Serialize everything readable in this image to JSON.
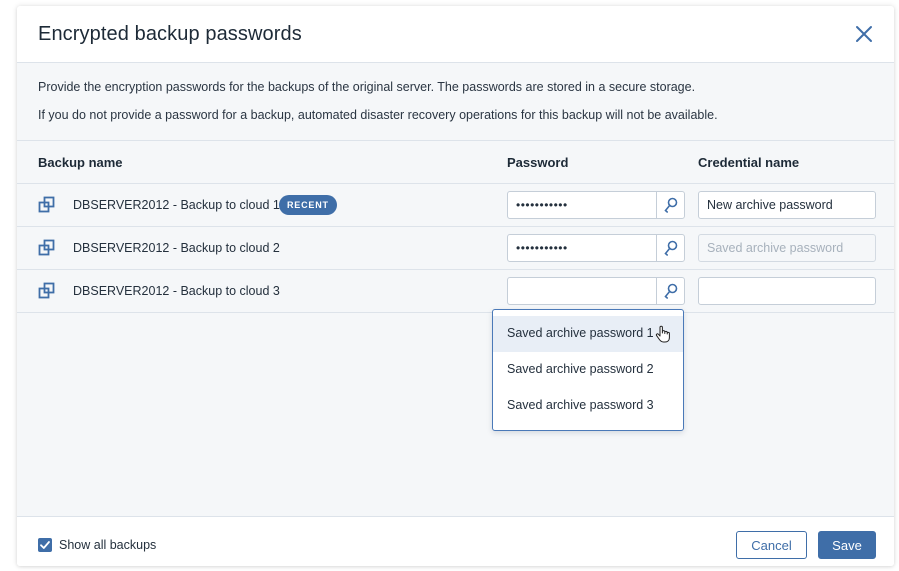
{
  "dialog": {
    "title": "Encrypted backup passwords",
    "info_line_1": "Provide the encryption passwords for the backups of the original server. The passwords are stored in a secure storage.",
    "info_line_2": "If you do not provide a password for a backup, automated disaster recovery operations for this backup will not be available."
  },
  "table": {
    "headers": {
      "backup_name": "Backup name",
      "password": "Password",
      "credential_name": "Credential name"
    },
    "rows": [
      {
        "name": "DBSERVER2012 - Backup to cloud 1",
        "badge": "RECENT",
        "password_masked": "•••••••••••",
        "credential_value": "New archive password",
        "credential_placeholder": ""
      },
      {
        "name": "DBSERVER2012 - Backup to cloud 2",
        "badge": "",
        "password_masked": "•••••••••••",
        "credential_value": "",
        "credential_placeholder": "Saved archive password"
      },
      {
        "name": "DBSERVER2012 - Backup to cloud 3",
        "badge": "",
        "password_masked": "",
        "credential_value": "",
        "credential_placeholder": ""
      }
    ]
  },
  "dropdown": {
    "options": [
      "Saved archive password 1",
      "Saved archive password 2",
      "Saved archive password 3"
    ],
    "hovered_index": 0
  },
  "footer": {
    "show_all_label": "Show all backups",
    "show_all_checked": true,
    "cancel_label": "Cancel",
    "save_label": "Save"
  },
  "icons": {
    "close": "close-icon",
    "backup": "backup-stack-icon",
    "key": "key-icon",
    "cursor": "hand-pointer-icon",
    "check": "checkmark-icon"
  },
  "colors": {
    "accent": "#3f6ea8",
    "border": "#dde3ea",
    "panel_bg": "#f5f7f9"
  }
}
